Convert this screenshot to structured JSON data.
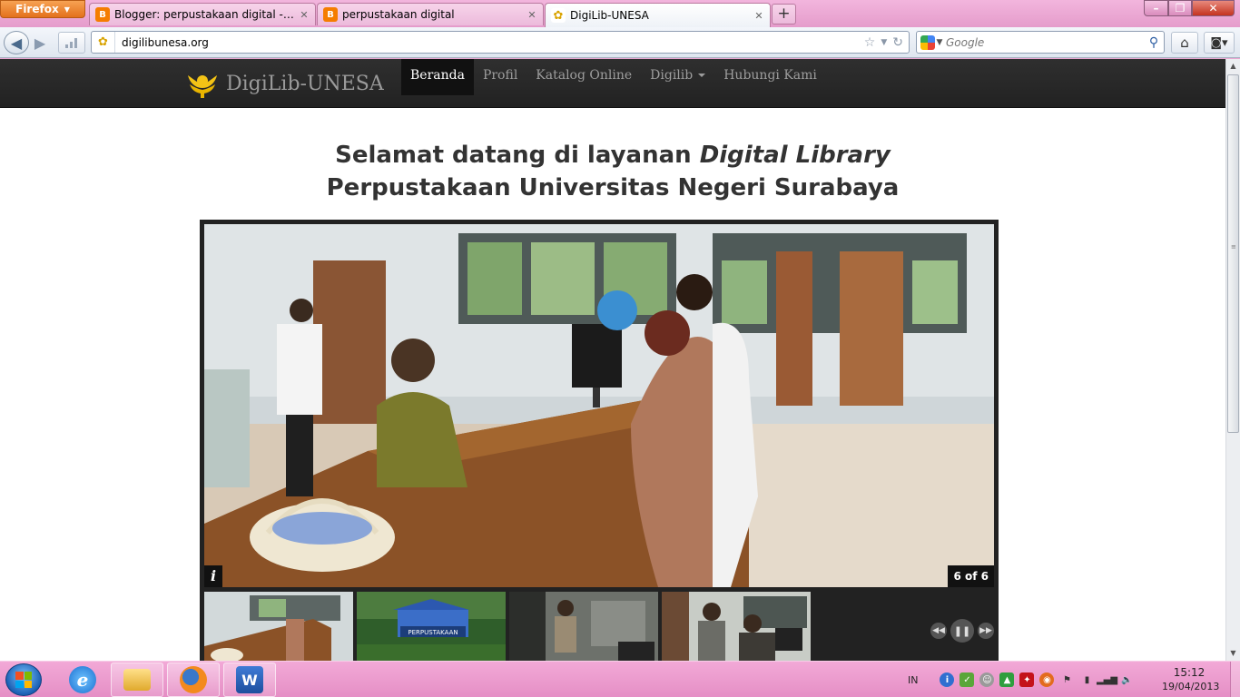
{
  "browser": {
    "app_button": "Firefox",
    "tabs": [
      {
        "label": "Blogger: perpustakaan digital - Buat l...",
        "favicon": "blogger-icon",
        "active": false
      },
      {
        "label": "perpustakaan digital",
        "favicon": "blogger-icon",
        "active": false
      },
      {
        "label": "DigiLib-UNESA",
        "favicon": "unesa-logo-icon",
        "active": true
      }
    ],
    "url": "digilibunesa.org",
    "search": {
      "placeholder": "Google"
    }
  },
  "site": {
    "brand": "DigiLib-UNESA",
    "menu": [
      {
        "label": "Beranda",
        "active": true
      },
      {
        "label": "Profil"
      },
      {
        "label": "Katalog Online"
      },
      {
        "label": "Digilib",
        "dropdown": true
      },
      {
        "label": "Hubungi Kami"
      }
    ],
    "welcome": {
      "line1_prefix": "Selamat datang di layanan ",
      "line1_italic": "Digital Library",
      "line2": "Perpustakaan Universitas Negeri Surabaya"
    },
    "slideshow": {
      "info_label": "i",
      "counter": "6 of 6",
      "thumbnails": [
        "library-desk-thumb",
        "perpustakaan-building-thumb",
        "library-computer-thumb",
        "library-reading-thumb"
      ]
    }
  },
  "taskbar": {
    "apps": [
      "internet-explorer-icon",
      "windows-explorer-icon",
      "firefox-icon",
      "word-icon"
    ],
    "language": "IN",
    "time": "15:12",
    "date": "19/04/2013"
  },
  "colors": {
    "site_nav_bg": "#2a2a2a",
    "taskbar_bg": "#e99ccd",
    "heading": "#333333"
  }
}
